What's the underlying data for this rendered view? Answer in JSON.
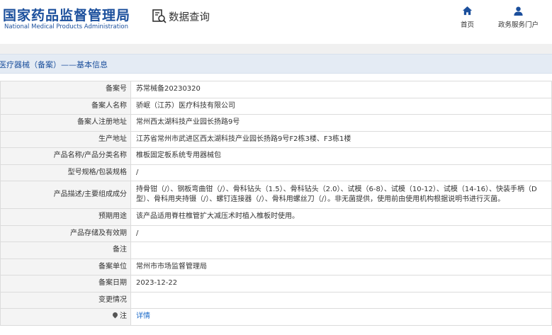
{
  "header": {
    "brand_cn": "国家药品监督管理局",
    "brand_en": "National Medical Products Administration",
    "query_label": "数据查询",
    "nav": {
      "home": "首页",
      "service": "政务服务门户"
    },
    "brand_color": "#1b4f9c"
  },
  "breadcrumb": "医疗器械（备案）——基本信息",
  "rows": [
    {
      "label": "备案号",
      "value": "苏常械备20230320"
    },
    {
      "label": "备案人名称",
      "value": "骄岷（江苏）医疗科技有限公司"
    },
    {
      "label": "备案人注册地址",
      "value": "常州西太湖科技产业园长扬路9号"
    },
    {
      "label": "生产地址",
      "value": "江苏省常州市武进区西太湖科技产业园长扬路9号F2栋3楼、F3栋1楼"
    },
    {
      "label": "产品名称/产品分类名称",
      "value": "椎板固定板系统专用器械包"
    },
    {
      "label": "型号规格/包装规格",
      "value": "/"
    },
    {
      "label": "产品描述/主要组成成分",
      "value": "持骨钳（/）、钢板弯曲钳（/）、骨科钻头（1.5）、骨科钻头（2.0）、试模（6-8）、试模（10-12）、试模（14-16）、快装手柄（D型）、骨科用夹持镊（/）、螺钉连接器（/）、骨科用螺丝刀（/）。非无菌提供，使用前由使用机构根据说明书进行灭菌。"
    },
    {
      "label": "预期用途",
      "value": "该产品适用脊柱椎管扩大减压术时植入椎板时使用。"
    },
    {
      "label": "产品存储及有效期",
      "value": "/"
    },
    {
      "label": "备注",
      "value": ""
    },
    {
      "label": "备案单位",
      "value": "常州市市场监督管理局"
    },
    {
      "label": "备案日期",
      "value": "2023-12-22"
    },
    {
      "label": "变更情况",
      "value": ""
    },
    {
      "label": "注",
      "value": "详情"
    }
  ]
}
